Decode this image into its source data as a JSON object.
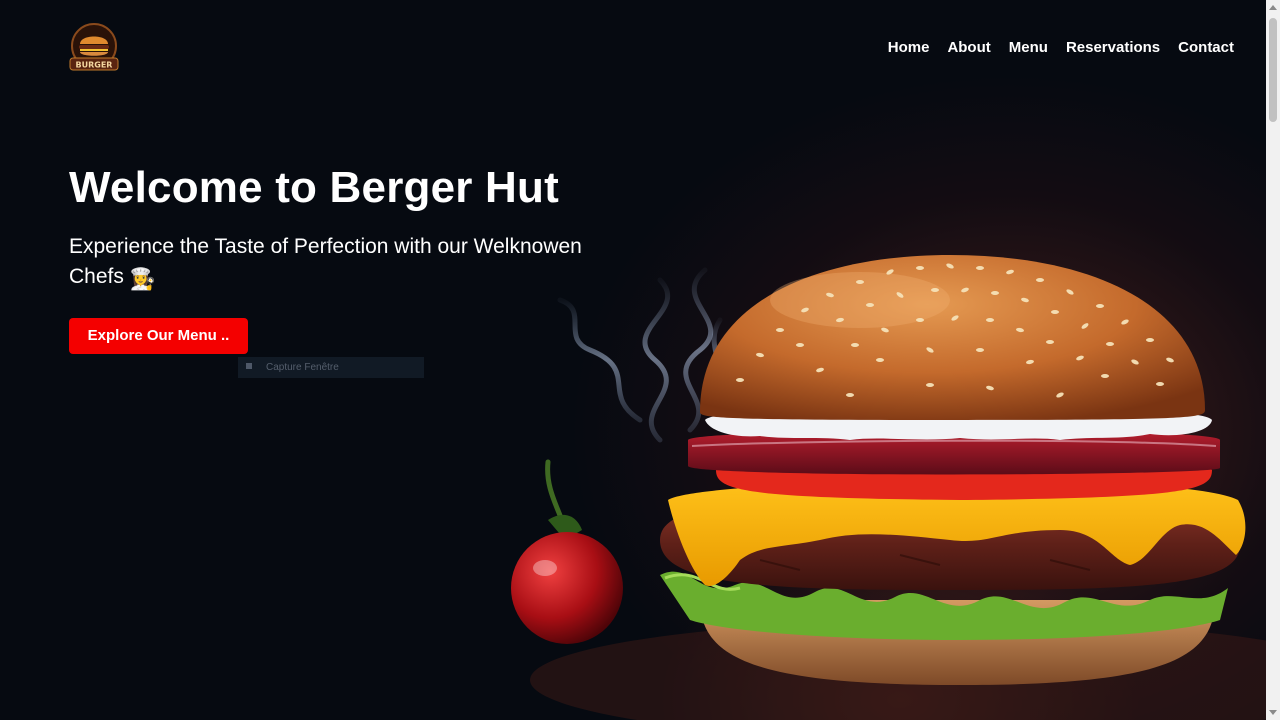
{
  "header": {
    "logo_text": "BURGER",
    "nav": {
      "home": "Home",
      "about": "About",
      "menu": "Menu",
      "reservations": "Reservations",
      "contact": "Contact"
    }
  },
  "hero": {
    "title": "Welcome to Berger Hut",
    "subtitle": "Experience the Taste of Perfection with our Welknowen Chefs",
    "subtitle_emoji": "👩‍🍳",
    "cta_label": "Explore Our Menu .."
  },
  "overlay": {
    "capture_tip": "Capture Fenêtre"
  },
  "colors": {
    "background": "#060a11",
    "cta": "#f40000",
    "text": "#ffffff"
  },
  "icons": {
    "logo": "burger-logo-icon",
    "chef": "chef-emoji-icon"
  }
}
